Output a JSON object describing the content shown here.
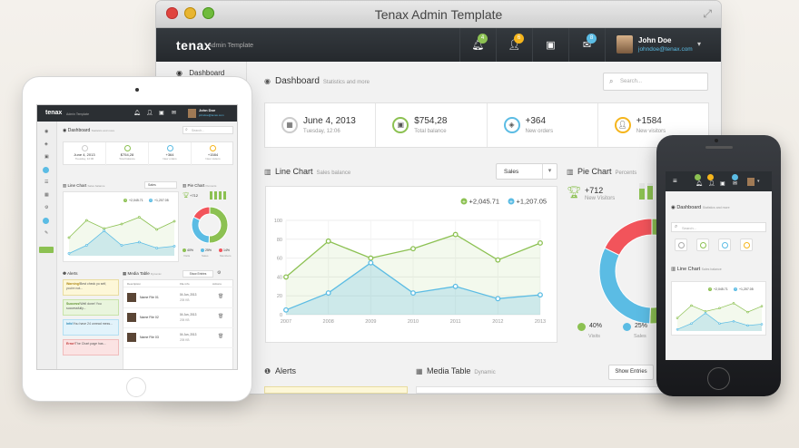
{
  "window": {
    "title": "Tenax Admin Template"
  },
  "brand": {
    "name": "tenax",
    "sub": "Admin Template"
  },
  "topnav": {
    "badges": {
      "notifications": "4",
      "users": "6",
      "messages": "8"
    },
    "badge_colors": {
      "notifications": "#8cc152",
      "users": "#f5b51c",
      "messages": "#5bbce4"
    }
  },
  "user": {
    "name": "John Doe",
    "email": "johndoe@tenax.com"
  },
  "sidebar": {
    "first_item": "Dashboard"
  },
  "header": {
    "title": "Dashboard",
    "subtitle": "Statistics and more"
  },
  "search": {
    "placeholder": "Search..."
  },
  "stats": [
    {
      "value": "June 4, 2013",
      "label": "Tuesday, 12:06",
      "icon": "calendar-icon",
      "color": "#cccccc"
    },
    {
      "value": "$754,28",
      "label": "Total balance",
      "icon": "picture-icon",
      "color": "#8cc152"
    },
    {
      "value": "+364",
      "label": "New orders",
      "icon": "tag-icon",
      "color": "#5bbce4"
    },
    {
      "value": "+1584",
      "label": "New visitors",
      "icon": "user-icon",
      "color": "#f5b51c"
    }
  ],
  "line_chart": {
    "title": "Line Chart",
    "subtitle": "Sales balance",
    "select_value": "Sales",
    "legend": [
      {
        "value": "+2,045.71",
        "color": "#8cc152"
      },
      {
        "value": "+1,207.05",
        "color": "#5bbce4"
      }
    ]
  },
  "pie_chart": {
    "title": "Pie Chart",
    "subtitle": "Percents",
    "trophy_value": "+712",
    "trophy_label": "New Visitors"
  },
  "alerts": {
    "title": "Alerts"
  },
  "media_table": {
    "title": "Media Table",
    "subtitle": "Dynamic",
    "button": "Show Entries"
  },
  "colors": {
    "green": "#8cc152",
    "blue": "#5bbce4",
    "red": "#f2545b",
    "orange": "#f5b51c",
    "dark": "#2b2f33"
  },
  "tablet": {
    "brand": "tenax",
    "brand_sub": "Admin Template",
    "user_name": "John Doe",
    "user_email": "johndoe@tenax.com",
    "search_placeholder": "Search...",
    "header_title": "Dashboard",
    "header_sub": "Statistics and more",
    "stats": [
      {
        "value": "June 4, 2013",
        "label": "Tuesday, 12:06"
      },
      {
        "value": "$754,28",
        "label": "Total balance"
      },
      {
        "value": "+364",
        "label": "New orders"
      },
      {
        "value": "+1584",
        "label": "New visitors"
      }
    ],
    "line_title": "Line Chart",
    "line_sub": "Sales balance",
    "select_value": "Sales",
    "legend_green": "+2,045.71",
    "legend_blue": "+1,207.05",
    "pie_title": "Pie Chart",
    "pie_sub": "Percents",
    "trophy_value": "+712",
    "pie_legend": [
      {
        "pct": "40%",
        "label": "Visits"
      },
      {
        "pct": "25%",
        "label": "Sales"
      },
      {
        "pct": "14%",
        "label": "Members"
      }
    ],
    "alerts_title": "Alerts",
    "alerts": [
      {
        "bold": "Warning!",
        "text": "Best check yo self, you're not...",
        "color": "#fdf7d8",
        "border": "#e8dca0",
        "bold_color": "#b08a18"
      },
      {
        "bold": "Success!",
        "text": "Well done! You successfully...",
        "color": "#e9f5dd",
        "border": "#c8e3a9",
        "bold_color": "#5d8f2b"
      },
      {
        "bold": "Info!",
        "text": "You have 24 unread mess...",
        "color": "#e2f3fb",
        "border": "#b3dff2",
        "bold_color": "#2f87b3"
      },
      {
        "bold": "Error!",
        "text": "The Chart page has...",
        "color": "#fbe3e3",
        "border": "#f0bcbc",
        "bold_color": "#c03a3a"
      }
    ],
    "media_title": "Media Table",
    "media_sub": "Dynamic",
    "media_button": "Show Entries",
    "media_headers": [
      "Description",
      "File info",
      "Actions"
    ],
    "media_rows": [
      {
        "name": "Name File 01",
        "date": "04 Jun, 2013",
        "size": "205 KB"
      },
      {
        "name": "Name File 02",
        "date": "04 Jun, 2013",
        "size": "205 KB"
      },
      {
        "name": "Name File 03",
        "date": "04 Jun, 2013",
        "size": "205 KB"
      }
    ]
  },
  "phone": {
    "search_placeholder": "Search...",
    "header_title": "Dashboard",
    "header_sub": "Statistics and more",
    "line_title": "Line Chart",
    "line_sub": "Sales balance",
    "legend_green": "+2,045.71",
    "legend_blue": "+1,207.05"
  },
  "chart_data": [
    {
      "type": "area",
      "x": [
        "2007",
        "2008",
        "2009",
        "2010",
        "2011",
        "2012",
        "2013"
      ],
      "ylim": [
        0,
        100
      ],
      "yticks": [
        0,
        20,
        40,
        60,
        80,
        100
      ],
      "grid": true,
      "series": [
        {
          "name": "+2,045.71",
          "values": [
            40,
            78,
            60,
            70,
            85,
            58,
            76
          ],
          "color": "#8cc152"
        },
        {
          "name": "+1,207.05",
          "values": [
            5,
            23,
            55,
            23,
            30,
            17,
            21
          ],
          "color": "#5bbce4"
        }
      ]
    },
    {
      "type": "pie",
      "labels": [
        "Visits",
        "Sales",
        "Members"
      ],
      "values": [
        40,
        25,
        14
      ],
      "percent_labels": [
        "40%",
        "25%",
        "14%"
      ],
      "colors": [
        "#8cc152",
        "#5bbce4",
        "#f2545b"
      ]
    }
  ]
}
